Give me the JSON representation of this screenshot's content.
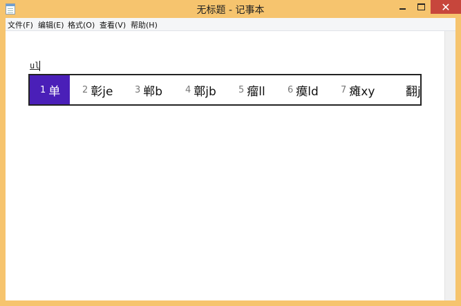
{
  "window": {
    "title": "无标题 - 记事本"
  },
  "menubar": [
    "文件(F)",
    "编辑(E)",
    "格式(O)",
    "查看(V)",
    "帮助(H)"
  ],
  "editor": {
    "composition_text": "ul"
  },
  "ime": {
    "candidates": [
      {
        "num": "1",
        "text": "单",
        "selected": true
      },
      {
        "num": "2",
        "text": "彰je"
      },
      {
        "num": "3",
        "text": "郸b"
      },
      {
        "num": "4",
        "text": "鄣jb"
      },
      {
        "num": "5",
        "text": "瘤ll"
      },
      {
        "num": "6",
        "text": "瘼ld"
      },
      {
        "num": "7",
        "text": "瘫xy"
      },
      {
        "num": "",
        "text": "翻ji"
      }
    ]
  }
}
